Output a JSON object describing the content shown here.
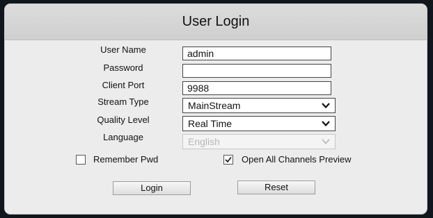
{
  "dialog": {
    "title": "User Login"
  },
  "form": {
    "user_name": {
      "label": "User Name",
      "value": "admin"
    },
    "password": {
      "label": "Password",
      "value": ""
    },
    "client_port": {
      "label": "Client Port",
      "value": "9988"
    },
    "stream_type": {
      "label": "Stream Type",
      "value": "MainStream"
    },
    "quality_level": {
      "label": "Quality Level",
      "value": "Real Time"
    },
    "language": {
      "label": "Language",
      "value": "English",
      "disabled": true
    }
  },
  "options": {
    "remember_pwd": {
      "label": "Remember Pwd",
      "checked": false
    },
    "open_all_channels_preview": {
      "label": "Open All Channels Preview",
      "checked": true
    }
  },
  "buttons": {
    "login": "Login",
    "reset": "Reset"
  },
  "icons": {
    "dropdown": "chevron-down-icon",
    "checkmark": "checkmark-icon"
  }
}
